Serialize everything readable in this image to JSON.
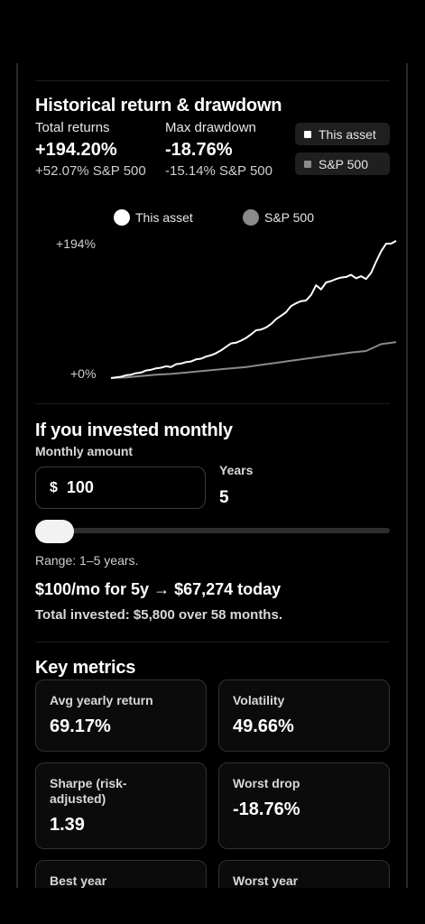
{
  "history": {
    "title": "Historical return & drawdown",
    "total_returns_label": "Total returns",
    "total_returns_value": "+194.20%",
    "total_returns_sub": "+52.07% S&P 500",
    "max_drawdown_label": "Max drawdown",
    "max_drawdown_value": "-18.76%",
    "max_drawdown_sub": "-15.14% S&P 500",
    "toggle_asset": "This asset",
    "toggle_sp500": "S&P 500"
  },
  "chart_data": {
    "type": "line",
    "legend": [
      "This asset",
      "S&P 500"
    ],
    "y_tick_labels": [
      "+194%",
      "+0%"
    ],
    "ylim": [
      0,
      194
    ],
    "series": [
      {
        "name": "This asset",
        "color": "#ffffff",
        "x": [
          0,
          1,
          2,
          3,
          4,
          5,
          6,
          7,
          8,
          9,
          10,
          11,
          12,
          13,
          14,
          15,
          16,
          17,
          18,
          19,
          20,
          21,
          22,
          23,
          24,
          25,
          26,
          27,
          28,
          29,
          30,
          31,
          32,
          33,
          34,
          35,
          36,
          37,
          38,
          39,
          40,
          41,
          42,
          43,
          44,
          45,
          46,
          47,
          48,
          49,
          50,
          51,
          52,
          53,
          54,
          55,
          56,
          57
        ],
        "values": [
          0,
          1,
          2,
          4,
          5,
          7,
          8,
          11,
          12,
          14,
          15,
          17,
          16,
          20,
          21,
          23,
          24,
          27,
          28,
          31,
          33,
          36,
          40,
          45,
          50,
          51,
          54,
          58,
          63,
          69,
          70,
          73,
          78,
          85,
          90,
          95,
          104,
          108,
          111,
          112,
          120,
          134,
          128,
          138,
          140,
          143,
          145,
          146,
          149,
          144,
          147,
          143,
          152,
          168,
          183,
          194,
          194,
          198
        ]
      },
      {
        "name": "S&P 500",
        "color": "#8a8a8a",
        "x": [
          0,
          3,
          6,
          9,
          12,
          15,
          18,
          21,
          24,
          27,
          30,
          33,
          36,
          39,
          42,
          45,
          48,
          51,
          54,
          57
        ],
        "values": [
          0,
          1,
          3,
          5,
          6,
          8,
          10,
          12,
          14,
          16,
          19,
          22,
          25,
          28,
          31,
          34,
          37,
          39,
          49,
          52
        ]
      }
    ]
  },
  "invest": {
    "title": "If you invested monthly",
    "monthly_amount_label": "Monthly amount",
    "currency": "$",
    "monthly_amount": "100",
    "years_label": "Years",
    "years": "5",
    "slider_value": 0,
    "range_text": "Range: 1–5 years.",
    "result": "$100/mo for 5y → $67,274 today",
    "total_invested": "Total invested: $5,800 over 58 months."
  },
  "metrics": {
    "title": "Key metrics",
    "cards": [
      {
        "label": "Avg yearly return",
        "value": "69.17%"
      },
      {
        "label": "Volatility",
        "value": "49.66%"
      },
      {
        "label": "Sharpe (risk-adjusted)",
        "value": "1.39"
      },
      {
        "label": "Worst drop",
        "value": "-18.76%"
      },
      {
        "label": "Best year",
        "value": ""
      },
      {
        "label": "Worst year",
        "value": ""
      }
    ]
  }
}
